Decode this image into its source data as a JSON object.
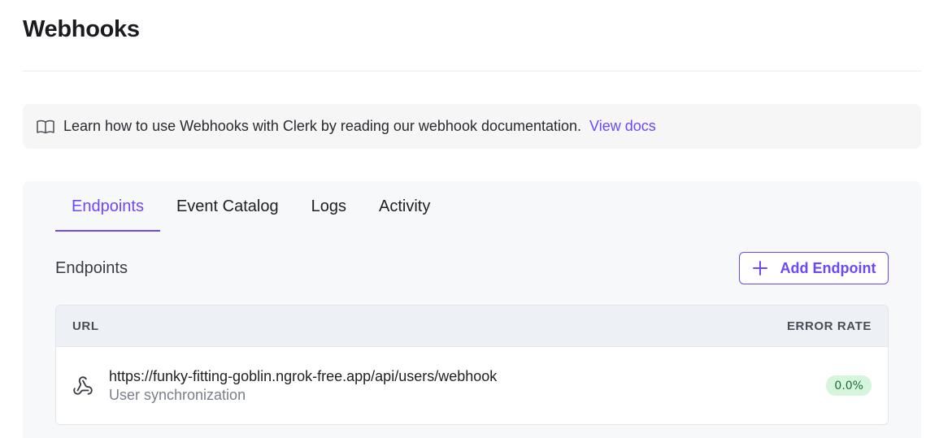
{
  "page": {
    "title": "Webhooks"
  },
  "banner": {
    "icon": "book-open-icon",
    "text": "Learn how to use Webhooks with Clerk by reading our webhook documentation.",
    "link_label": "View docs"
  },
  "tabs": [
    {
      "label": "Endpoints",
      "active": true
    },
    {
      "label": "Event Catalog",
      "active": false
    },
    {
      "label": "Logs",
      "active": false
    },
    {
      "label": "Activity",
      "active": false
    }
  ],
  "section": {
    "title": "Endpoints"
  },
  "add_button": {
    "icon": "plus-icon",
    "label": "Add Endpoint"
  },
  "table": {
    "columns": [
      "URL",
      "ERROR RATE"
    ],
    "rows": [
      {
        "icon": "webhook-icon",
        "url": "https://funky-fitting-goblin.ngrok-free.app/api/users/webhook",
        "description": "User synchronization",
        "error_rate": "0.0%"
      }
    ]
  },
  "colors": {
    "accent": "#6c47ff",
    "badge_bg": "#d6f5dd",
    "badge_text": "#1e6b35"
  }
}
